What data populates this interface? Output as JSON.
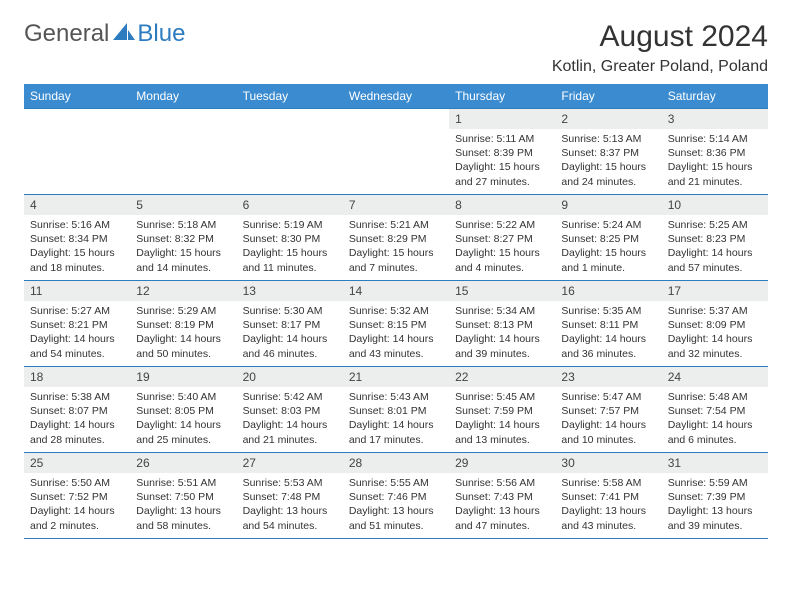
{
  "logo": {
    "general": "General",
    "blue": "Blue"
  },
  "title": "August 2024",
  "location": "Kotlin, Greater Poland, Poland",
  "weekdays": [
    "Sunday",
    "Monday",
    "Tuesday",
    "Wednesday",
    "Thursday",
    "Friday",
    "Saturday"
  ],
  "weeks": [
    [
      null,
      null,
      null,
      null,
      {
        "n": "1",
        "sr": "5:11 AM",
        "ss": "8:39 PM",
        "dl": "15 hours and 27 minutes."
      },
      {
        "n": "2",
        "sr": "5:13 AM",
        "ss": "8:37 PM",
        "dl": "15 hours and 24 minutes."
      },
      {
        "n": "3",
        "sr": "5:14 AM",
        "ss": "8:36 PM",
        "dl": "15 hours and 21 minutes."
      }
    ],
    [
      {
        "n": "4",
        "sr": "5:16 AM",
        "ss": "8:34 PM",
        "dl": "15 hours and 18 minutes."
      },
      {
        "n": "5",
        "sr": "5:18 AM",
        "ss": "8:32 PM",
        "dl": "15 hours and 14 minutes."
      },
      {
        "n": "6",
        "sr": "5:19 AM",
        "ss": "8:30 PM",
        "dl": "15 hours and 11 minutes."
      },
      {
        "n": "7",
        "sr": "5:21 AM",
        "ss": "8:29 PM",
        "dl": "15 hours and 7 minutes."
      },
      {
        "n": "8",
        "sr": "5:22 AM",
        "ss": "8:27 PM",
        "dl": "15 hours and 4 minutes."
      },
      {
        "n": "9",
        "sr": "5:24 AM",
        "ss": "8:25 PM",
        "dl": "15 hours and 1 minute."
      },
      {
        "n": "10",
        "sr": "5:25 AM",
        "ss": "8:23 PM",
        "dl": "14 hours and 57 minutes."
      }
    ],
    [
      {
        "n": "11",
        "sr": "5:27 AM",
        "ss": "8:21 PM",
        "dl": "14 hours and 54 minutes."
      },
      {
        "n": "12",
        "sr": "5:29 AM",
        "ss": "8:19 PM",
        "dl": "14 hours and 50 minutes."
      },
      {
        "n": "13",
        "sr": "5:30 AM",
        "ss": "8:17 PM",
        "dl": "14 hours and 46 minutes."
      },
      {
        "n": "14",
        "sr": "5:32 AM",
        "ss": "8:15 PM",
        "dl": "14 hours and 43 minutes."
      },
      {
        "n": "15",
        "sr": "5:34 AM",
        "ss": "8:13 PM",
        "dl": "14 hours and 39 minutes."
      },
      {
        "n": "16",
        "sr": "5:35 AM",
        "ss": "8:11 PM",
        "dl": "14 hours and 36 minutes."
      },
      {
        "n": "17",
        "sr": "5:37 AM",
        "ss": "8:09 PM",
        "dl": "14 hours and 32 minutes."
      }
    ],
    [
      {
        "n": "18",
        "sr": "5:38 AM",
        "ss": "8:07 PM",
        "dl": "14 hours and 28 minutes."
      },
      {
        "n": "19",
        "sr": "5:40 AM",
        "ss": "8:05 PM",
        "dl": "14 hours and 25 minutes."
      },
      {
        "n": "20",
        "sr": "5:42 AM",
        "ss": "8:03 PM",
        "dl": "14 hours and 21 minutes."
      },
      {
        "n": "21",
        "sr": "5:43 AM",
        "ss": "8:01 PM",
        "dl": "14 hours and 17 minutes."
      },
      {
        "n": "22",
        "sr": "5:45 AM",
        "ss": "7:59 PM",
        "dl": "14 hours and 13 minutes."
      },
      {
        "n": "23",
        "sr": "5:47 AM",
        "ss": "7:57 PM",
        "dl": "14 hours and 10 minutes."
      },
      {
        "n": "24",
        "sr": "5:48 AM",
        "ss": "7:54 PM",
        "dl": "14 hours and 6 minutes."
      }
    ],
    [
      {
        "n": "25",
        "sr": "5:50 AM",
        "ss": "7:52 PM",
        "dl": "14 hours and 2 minutes."
      },
      {
        "n": "26",
        "sr": "5:51 AM",
        "ss": "7:50 PM",
        "dl": "13 hours and 58 minutes."
      },
      {
        "n": "27",
        "sr": "5:53 AM",
        "ss": "7:48 PM",
        "dl": "13 hours and 54 minutes."
      },
      {
        "n": "28",
        "sr": "5:55 AM",
        "ss": "7:46 PM",
        "dl": "13 hours and 51 minutes."
      },
      {
        "n": "29",
        "sr": "5:56 AM",
        "ss": "7:43 PM",
        "dl": "13 hours and 47 minutes."
      },
      {
        "n": "30",
        "sr": "5:58 AM",
        "ss": "7:41 PM",
        "dl": "13 hours and 43 minutes."
      },
      {
        "n": "31",
        "sr": "5:59 AM",
        "ss": "7:39 PM",
        "dl": "13 hours and 39 minutes."
      }
    ]
  ],
  "labels": {
    "sunrise": "Sunrise: ",
    "sunset": "Sunset: ",
    "daylight": "Daylight: "
  }
}
